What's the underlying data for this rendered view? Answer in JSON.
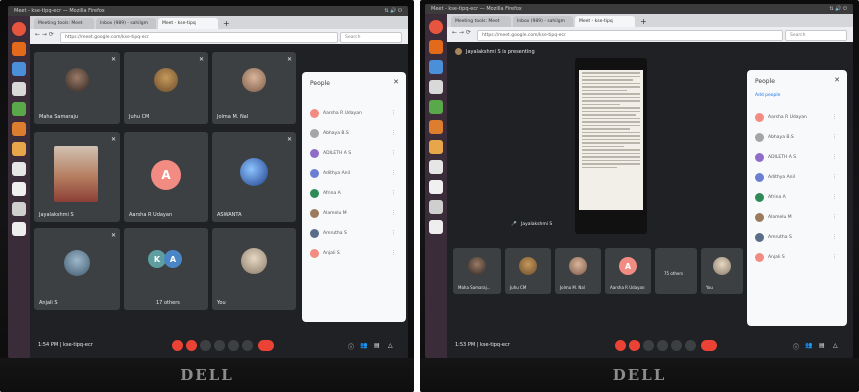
{
  "brand": "DELL",
  "window_title": "Meet - kse-tipq-ecr — Mozilla Firefox",
  "tabs": [
    "Meeting tools: Meet",
    "Inbox (989) - sahilgm",
    "Meet - kse-tipq"
  ],
  "url": "https://meet.google.com/kse-tipq-ecr",
  "search_placeholder": "Search",
  "left": {
    "tiles": [
      {
        "name": "Maha Samaraju"
      },
      {
        "name": "Juhu CM"
      },
      {
        "name": "Jolma M. Nal"
      },
      {
        "name": "Jayalakshmi S"
      },
      {
        "name": "Aarsha R Udayan",
        "letter": "A"
      },
      {
        "name": "ASWANTA"
      },
      {
        "name": "Anjali S"
      },
      {
        "name": "17 others",
        "letters": [
          "K",
          "A"
        ]
      },
      {
        "name": "You"
      }
    ],
    "people_title": "People",
    "clock": "1:54 PM  |  kse-tipq-ecr"
  },
  "right": {
    "presenting": "Jayalakshmi S is presenting",
    "pres_label": "Jayalakshmi S",
    "people_title": "People",
    "add_people": "Add people",
    "participants": [
      "Aarsha R Udayan",
      "Abhaya B.S",
      "ADILETH A S",
      "Adithya Anil",
      "Afrina A",
      "Alamelu M",
      "Amrutha S",
      "Anjali S"
    ],
    "strip": [
      {
        "name": "Maha Samaraj..."
      },
      {
        "name": "Juhu CM"
      },
      {
        "name": "Jolma M. Nal"
      },
      {
        "name": "Aarsha R Udayan",
        "letter": "A"
      },
      {
        "name": "75 others"
      },
      {
        "name": "You"
      }
    ],
    "clock": "1:53 PM  |  kse-tipq-ecr"
  },
  "colors": {
    "meet_bg": "#202124",
    "tile_bg": "#3c4043",
    "end_call": "#ea4335",
    "avatar_pink": "#f28b82",
    "dock_bg": "#3a2c38"
  }
}
